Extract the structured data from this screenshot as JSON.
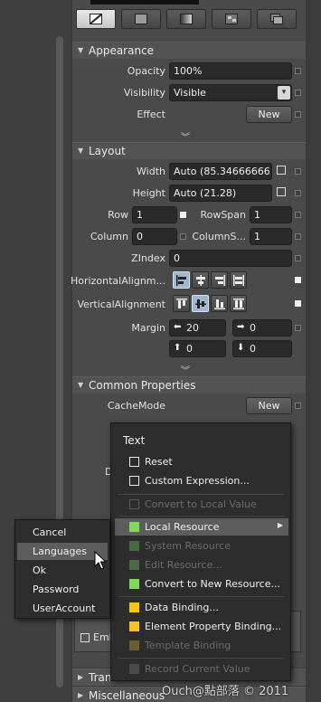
{
  "colors": {
    "accent_green": "#7ed957",
    "accent_yellow": "#f5c518",
    "disabled_green": "#4a6a43",
    "disabled_yellow": "#6a5f30",
    "menu_bg": "#2d2d2d",
    "panel_bg": "#4a4a4a"
  },
  "brush_tabs": [
    "no-brush-icon",
    "solid-brush-icon",
    "gradient-brush-icon",
    "tile-brush-icon",
    "resource-brush-icon"
  ],
  "appearance": {
    "title": "Appearance",
    "opacity_label": "Opacity",
    "opacity_value": "100%",
    "visibility_label": "Visibility",
    "visibility_value": "Visible",
    "effect_label": "Effect",
    "effect_button": "New"
  },
  "layout": {
    "title": "Layout",
    "width_label": "Width",
    "width_value": "Auto (85.34666666...",
    "height_label": "Height",
    "height_value": "Auto (21.28)",
    "row_label": "Row",
    "row_value": "1",
    "rowspan_label": "RowSpan",
    "rowspan_value": "1",
    "column_label": "Column",
    "column_value": "0",
    "columnspan_label": "ColumnS...",
    "columnspan_value": "1",
    "zindex_label": "ZIndex",
    "zindex_value": "0",
    "halign_label": "HorizontalAlignm...",
    "valign_label": "VerticalAlignment",
    "margin_label": "Margin",
    "margin_left": "20",
    "margin_right": "0",
    "margin_top": "0",
    "margin_bottom": "0"
  },
  "common": {
    "title": "Common Properties",
    "cachemode_label": "CacheMode",
    "cachemode_button": "New",
    "partial_label": "D",
    "embed_label": "Emb"
  },
  "collapsed_sections": [
    "Trans",
    "Miscellaneous"
  ],
  "context_menu": {
    "header": "Text",
    "items": [
      {
        "label": "Reset",
        "icon": "checkbox-icon",
        "enabled": true
      },
      {
        "label": "Custom Expression...",
        "icon": "checkbox-icon",
        "enabled": true
      },
      {
        "label": "Convert to Local Value",
        "icon": "checkbox-icon",
        "enabled": false
      },
      {
        "label": "Local Resource",
        "icon": "local-resource-icon",
        "enabled": true,
        "highlighted": true,
        "submenu": true
      },
      {
        "label": "System Resource",
        "icon": "system-resource-icon",
        "enabled": false
      },
      {
        "label": "Edit Resource...",
        "icon": "edit-resource-icon",
        "enabled": false
      },
      {
        "label": "Convert to New Resource...",
        "icon": "new-resource-icon",
        "enabled": true
      },
      {
        "label": "Data Binding...",
        "icon": "data-binding-icon",
        "enabled": true
      },
      {
        "label": "Element Property Binding...",
        "icon": "element-binding-icon",
        "enabled": true
      },
      {
        "label": "Template Binding",
        "icon": "template-binding-icon",
        "enabled": false
      },
      {
        "label": "Record Current Value",
        "icon": "record-icon",
        "enabled": false
      }
    ]
  },
  "resource_submenu": {
    "items": [
      "Cancel",
      "Languages",
      "Ok",
      "Password",
      "UserAccount"
    ],
    "highlighted": "Languages"
  },
  "watermark": "Ouch@點部落 © 2011"
}
